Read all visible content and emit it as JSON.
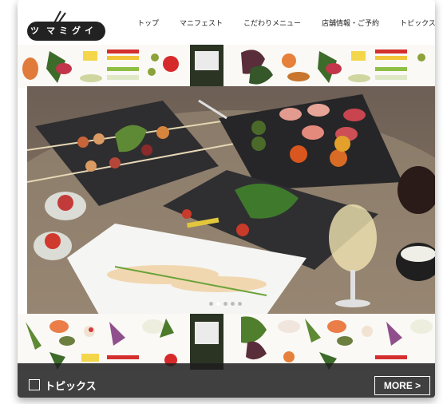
{
  "header": {
    "logo_mark": "ツ",
    "logo_text": "マミグイ",
    "nav": [
      {
        "label": "トップ"
      },
      {
        "label": "マニフェスト"
      },
      {
        "label": "こだわりメニュー"
      },
      {
        "label": "店舗情報・ご予約"
      },
      {
        "label": "トピックス"
      }
    ]
  },
  "hero": {
    "slide_count": 5,
    "active_slide": 1
  },
  "topics_bar": {
    "label": "トピックス",
    "more_label": "MORE >"
  },
  "colors": {
    "header_bg": "#ffffff",
    "bar_bg": "#1e1e1e",
    "text": "#222222"
  }
}
